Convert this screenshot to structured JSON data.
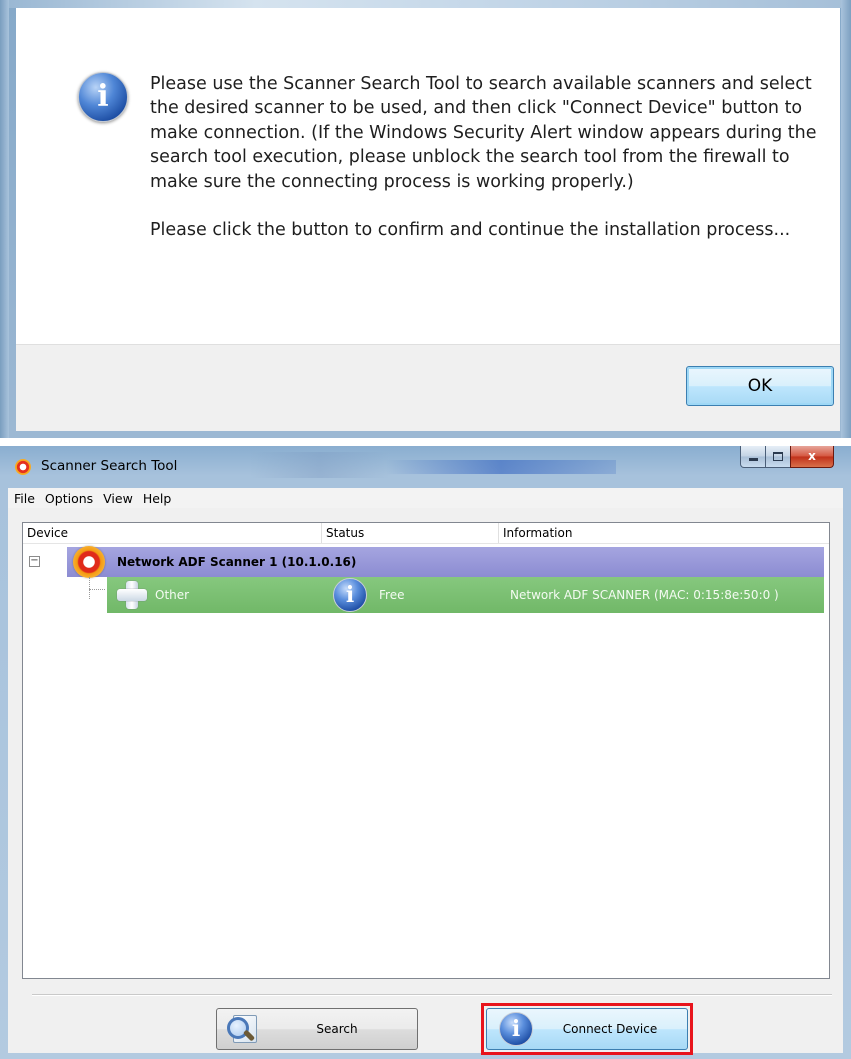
{
  "message_dialog": {
    "paragraphs": [
      "Please use the Scanner Search Tool to search available scanners and select the desired scanner to be used, and then click \"Connect Device\" button to make connection. (If the Windows Security Alert window appears during the search tool execution, please unblock the search tool from the firewall to make sure the connecting process is working properly.)",
      "Please click the button to confirm and continue the installation process..."
    ],
    "ok_label": "OK",
    "icon": "info-icon"
  },
  "app": {
    "title": "Scanner Search Tool",
    "icon": "scanner-app-icon",
    "menu": [
      "File",
      "Options",
      "View",
      "Help"
    ],
    "columns": [
      "Device",
      "Status",
      "Information"
    ],
    "tree": {
      "toggle_glyph": "−",
      "parent": {
        "label": "Network ADF Scanner 1  (10.1.0.16)",
        "icon": "scanner-device-icon"
      },
      "child": {
        "device": "Other",
        "device_icon": "plus-icon",
        "status": "Free",
        "status_icon": "info-icon",
        "information": "Network  ADF SCANNER  (MAC: 0:15:8e:50:0 )"
      }
    },
    "buttons": {
      "search": "Search",
      "connect": "Connect Device"
    },
    "colors": {
      "parent_row": "#8c8cd2",
      "child_row": "#71b868",
      "highlight": "#e8141c"
    }
  }
}
